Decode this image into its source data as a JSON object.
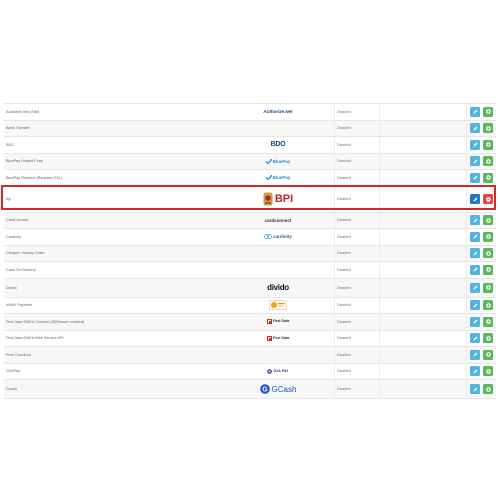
{
  "rows": [
    {
      "name": "Authorize.Net (SIM)",
      "logo_text": "Authorize.Net",
      "status": "Disabled"
    },
    {
      "name": "Bank Transfer",
      "logo_text": "",
      "status": "Disabled"
    },
    {
      "name": "BDO",
      "logo_text": "BDO",
      "status": "Disabled"
    },
    {
      "name": "BluePay Hosted Form",
      "logo_text": "BluePay",
      "status": "Disabled"
    },
    {
      "name": "BluePay Redirect (Requires SSL)",
      "logo_text": "BluePay",
      "status": "Disabled"
    },
    {
      "name": "bpi",
      "logo_text": "BPI",
      "status": "Disabled"
    },
    {
      "name": "CardConnect",
      "logo_text": "cardconnect",
      "status": "Disabled"
    },
    {
      "name": "Cardinity",
      "logo_text": "cardinity",
      "status": "Disabled"
    },
    {
      "name": "Cheque / Money Order",
      "logo_text": "",
      "status": "Disabled"
    },
    {
      "name": "Cash On Delivery",
      "logo_text": "",
      "status": "Disabled"
    },
    {
      "name": "Divido",
      "logo_text": "divido",
      "status": "Disabled"
    },
    {
      "name": "eWAY Payment",
      "logo_text": "",
      "status": "Disabled"
    },
    {
      "name": "First Data EMEA Connect (3DSecure enabled)",
      "logo_text": "First Data",
      "status": "Disabled"
    },
    {
      "name": "First Data EMEA Web Service API",
      "logo_text": "First Data",
      "status": "Disabled"
    },
    {
      "name": "Free Checkout",
      "logo_text": "",
      "status": "Disabled"
    },
    {
      "name": "G2APay",
      "logo_text": "G2A PAY",
      "status": "Disabled"
    },
    {
      "name": "Gcash",
      "logo_text": "GCash",
      "status": "Disabled"
    }
  ],
  "highlighted_row": "bpi",
  "colors": {
    "edit_button": "#55b3e0",
    "install_button": "#5cb85c",
    "highlight_border": "#d22a2a",
    "uninstall_button": "#e04848"
  }
}
